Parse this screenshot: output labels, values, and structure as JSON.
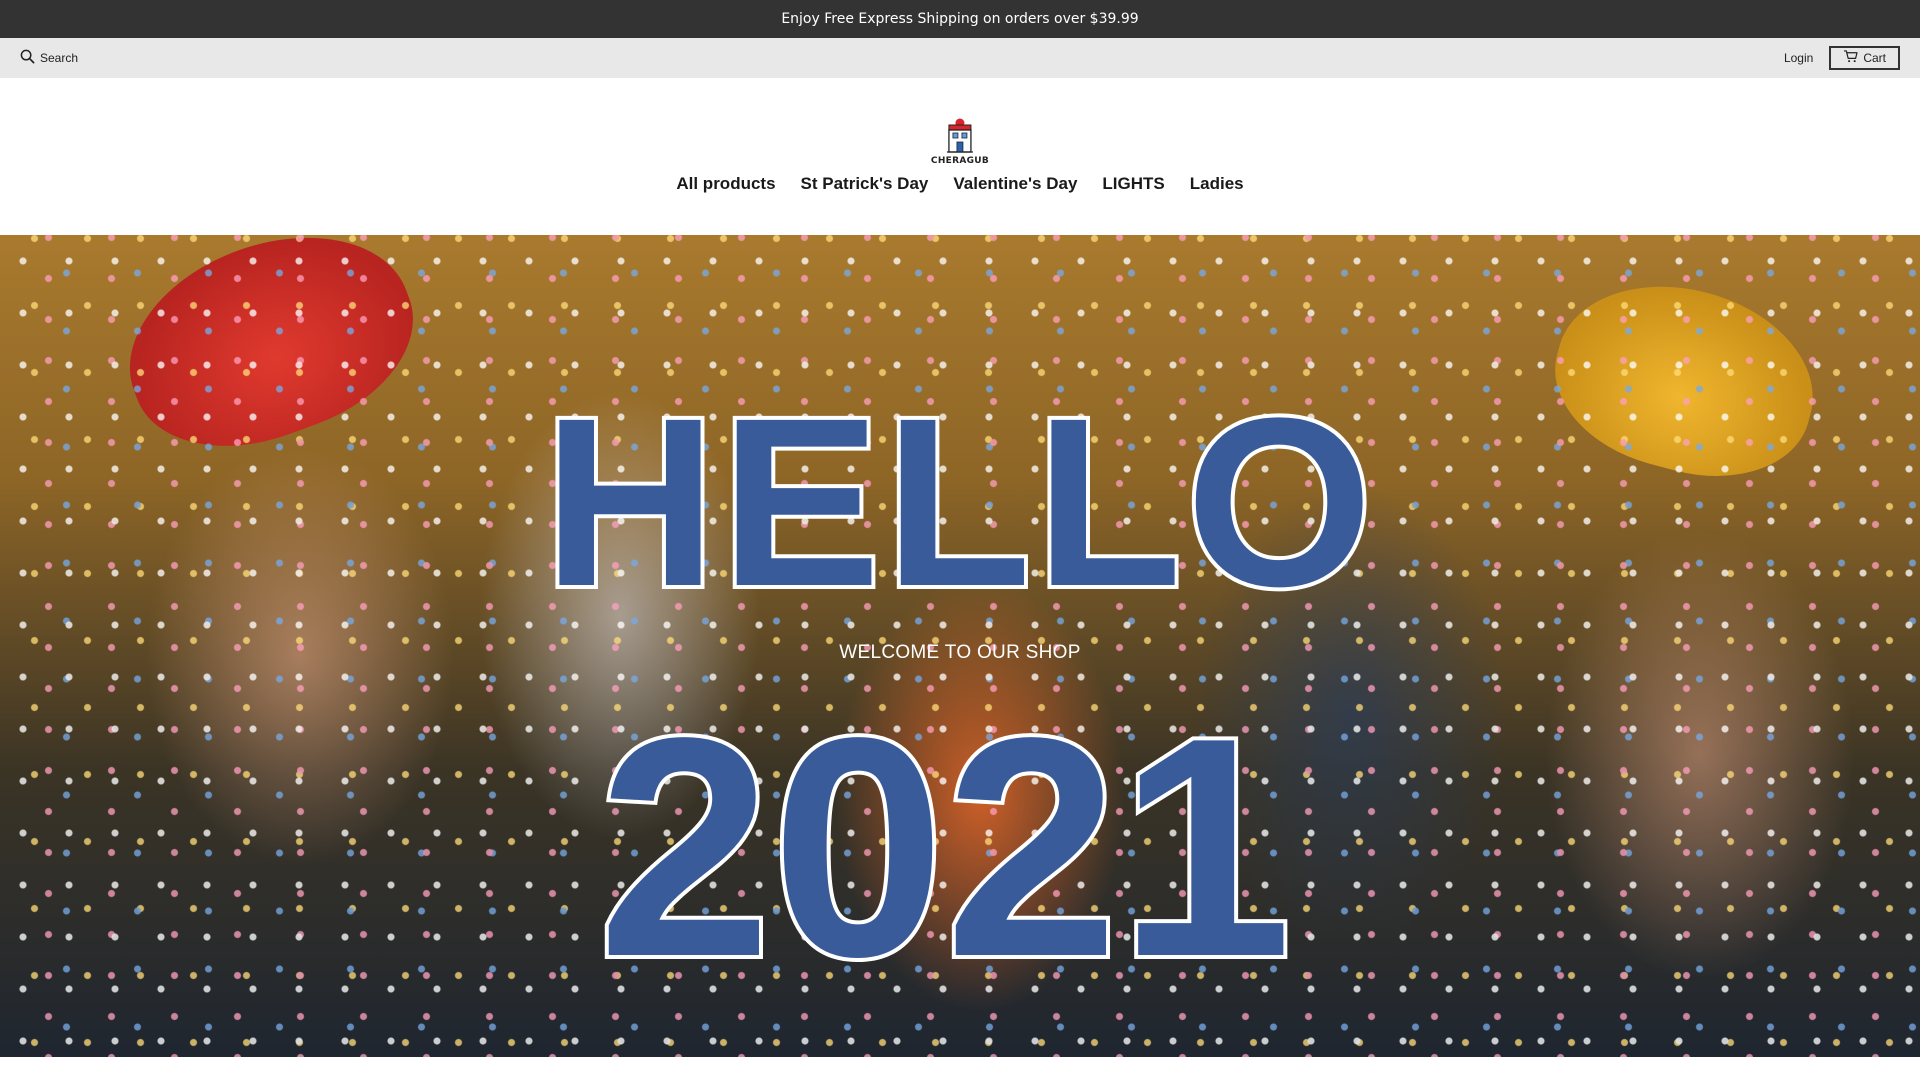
{
  "announcement": {
    "text": "Enjoy Free Express Shipping on orders over $39.99"
  },
  "utility": {
    "search_label": "Search",
    "search_icon": "search-icon",
    "login_label": "Login",
    "cart_label": "Cart",
    "cart_icon": "cart-icon"
  },
  "brand": {
    "logo_text": "CHERAGUB"
  },
  "nav": {
    "items": [
      {
        "label": "All products"
      },
      {
        "label": "St Patrick's Day"
      },
      {
        "label": "Valentine's Day"
      },
      {
        "label": "LIGHTS"
      },
      {
        "label": "Ladies"
      }
    ]
  },
  "hero": {
    "headline": "HELLO",
    "subheadline": "WELCOME TO OUR SHOP",
    "year": "2021",
    "text_color": "#3a5b9a"
  },
  "colors": {
    "announcement_bg": "#333333",
    "utility_bg": "#e8e8e8"
  }
}
